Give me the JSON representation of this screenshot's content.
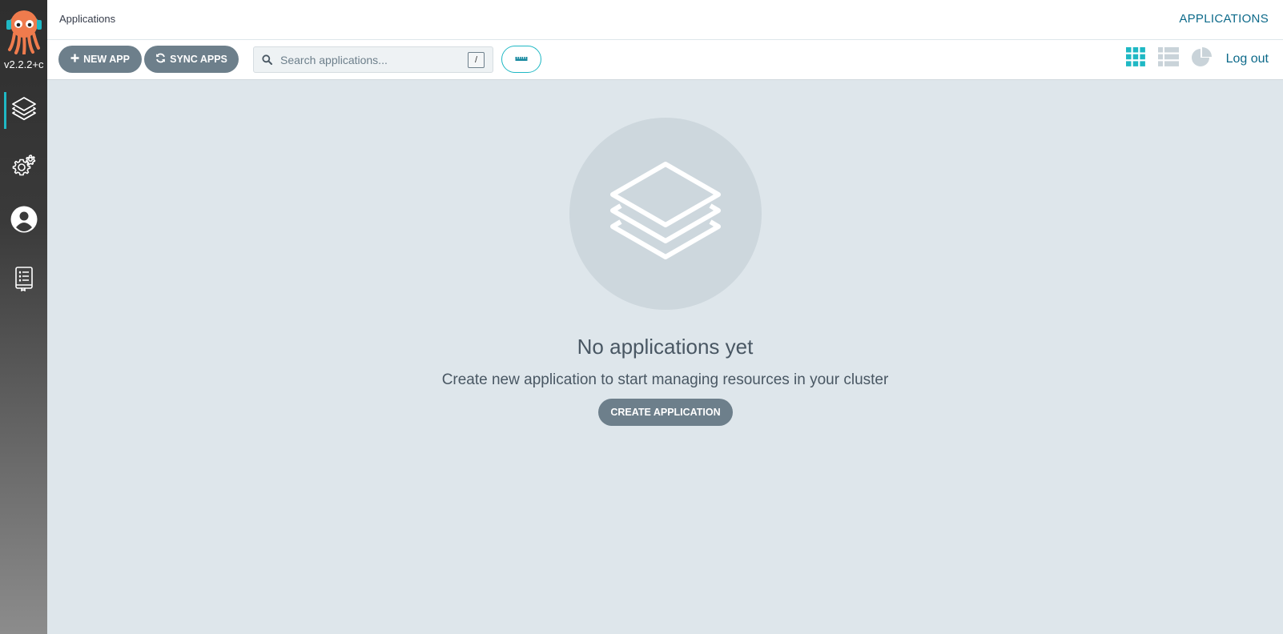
{
  "app": {
    "version": "v2.2.2+c",
    "accent_color": "#1fb8c4",
    "brand_color": "#ef7b4d"
  },
  "sidebar": {
    "items": [
      {
        "icon": "layers-icon",
        "label": "Applications",
        "active": true
      },
      {
        "icon": "settings-icon",
        "label": "Settings",
        "active": false
      },
      {
        "icon": "user-icon",
        "label": "User Info",
        "active": false
      },
      {
        "icon": "docs-icon",
        "label": "Documentation",
        "active": false
      }
    ]
  },
  "header": {
    "breadcrumb": "Applications",
    "title": "APPLICATIONS"
  },
  "toolbar": {
    "new_app_label": "NEW APP",
    "sync_apps_label": "SYNC APPS",
    "search_placeholder": "Search applications...",
    "search_shortcut": "/",
    "view_modes": [
      "tiles-view-icon",
      "list-view-icon",
      "summary-view-icon"
    ],
    "active_view": "tiles",
    "logout_label": "Log out"
  },
  "empty_state": {
    "title": "No applications yet",
    "subtitle": "Create new application to start managing resources in your cluster",
    "button_label": "CREATE APPLICATION"
  }
}
